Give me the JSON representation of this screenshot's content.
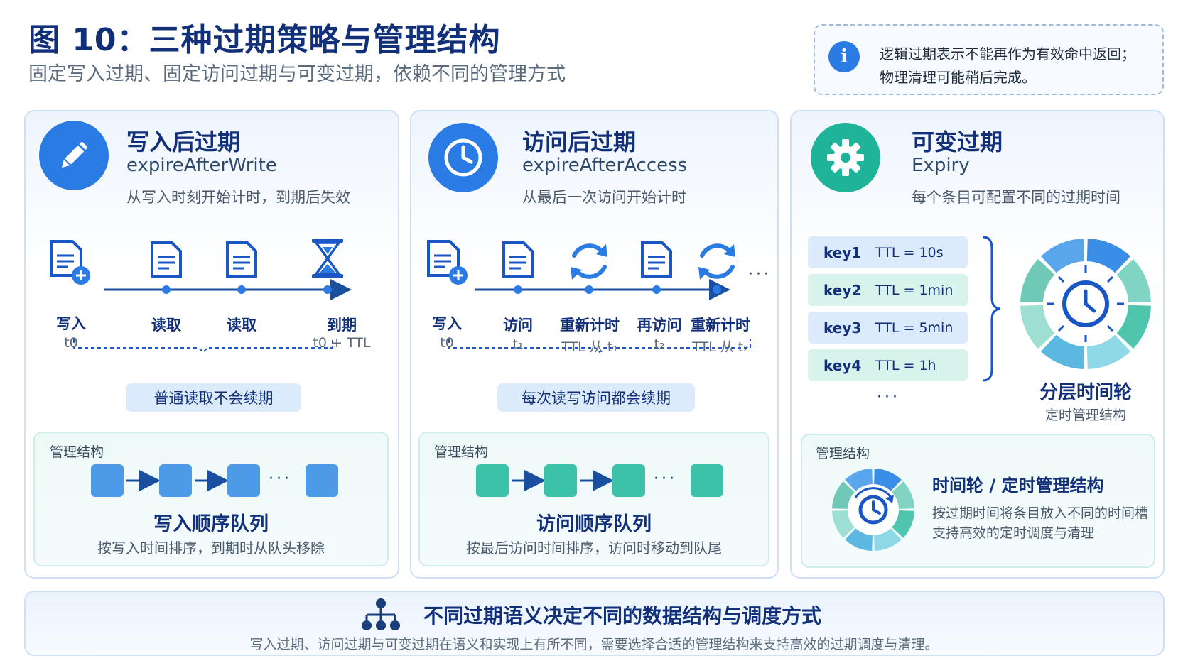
{
  "header": {
    "title": "图 10：三种过期策略与管理结构",
    "subtitle": "固定写入过期、固定访问过期与可变过期，依赖不同的管理方式",
    "info_icon": "i",
    "info_line1": "逻辑过期表示不能再作为有效命中返回；",
    "info_line2": "物理清理可能稍后完成。"
  },
  "colors": {
    "title": "#12307a",
    "blue": "#2a7be4",
    "teal": "#1fb39a",
    "light_blue": "#4d9ae6",
    "light_teal": "#3cc2a8"
  },
  "panel1": {
    "icon": "pencil-icon",
    "title": "写入后过期",
    "en": "expireAfterWrite",
    "desc": "从写入时刻开始计时，到期后失效",
    "nodes": [
      {
        "label": "写入",
        "sub": "t0",
        "icon": "document-add-icon"
      },
      {
        "label": "读取",
        "sub": "",
        "icon": "document-icon"
      },
      {
        "label": "读取",
        "sub": "",
        "icon": "document-icon"
      },
      {
        "label": "到期",
        "sub": "t0 + TTL",
        "icon": "hourglass-icon"
      }
    ],
    "pill": "普通读取不会续期",
    "mgmt_label": "管理结构",
    "queue_title": "写入顺序队列",
    "queue_desc": "按写入时间排序，到期时从队头移除",
    "queue_dots": "···"
  },
  "panel2": {
    "icon": "clock-icon",
    "title": "访问后过期",
    "en": "expireAfterAccess",
    "desc": "从最后一次访问开始计时",
    "nodes": [
      {
        "label": "写入",
        "sub": "t0",
        "icon": "document-add-icon"
      },
      {
        "label": "访问",
        "sub": "t₁",
        "icon": "document-icon"
      },
      {
        "label": "重新计时",
        "sub": "TTL 从 t₁",
        "icon": "refresh-icon"
      },
      {
        "label": "再访问",
        "sub": "t₂",
        "icon": "document-icon"
      },
      {
        "label": "重新计时",
        "sub": "TTL 从 t₂",
        "icon": "refresh-icon"
      }
    ],
    "trail_dots": "···",
    "pill": "每次读写访问都会续期",
    "mgmt_label": "管理结构",
    "queue_title": "访问顺序队列",
    "queue_desc": "按最后访问时间排序，访问时移动到队尾",
    "queue_dots": "···"
  },
  "panel3": {
    "icon": "gear-icon",
    "title": "可变过期",
    "en": "Expiry",
    "desc": "每个条目可配置不同的过期时间",
    "keys": [
      {
        "key": "key1",
        "ttl": "TTL = 10s"
      },
      {
        "key": "key2",
        "ttl": "TTL = 1min"
      },
      {
        "key": "key3",
        "ttl": "TTL = 5min"
      },
      {
        "key": "key4",
        "ttl": "TTL = 1h"
      }
    ],
    "keys_more": "···",
    "wheel_title": "分层时间轮",
    "wheel_desc": "定时管理结构",
    "mgmt_label": "管理结构",
    "mgmt_title": "时间轮  /  定时管理结构",
    "mgmt_line1": "按过期时间将条目放入不同的时间槽",
    "mgmt_line2": "支持高效的定时调度与清理"
  },
  "footer": {
    "icon": "hierarchy-icon",
    "title": "不同过期语义决定不同的数据结构与调度方式",
    "desc": "写入过期、访问过期与可变过期在语义和实现上有所不同，需要选择合适的管理结构来支持高效的过期调度与清理。"
  }
}
